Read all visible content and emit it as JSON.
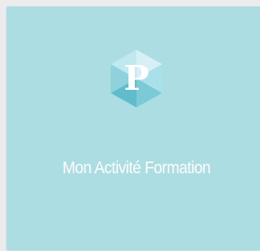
{
  "tile": {
    "title": "Mon Activité Formation",
    "background_color": "#acdde3",
    "text_color": "#ffffff"
  },
  "logo": {
    "icon": "hexagon-p-logo-icon",
    "letter": "P",
    "colors": {
      "hex_light": "#d6f0f5",
      "hex_mid": "#8fd2dd",
      "hex_dark": "#5ebccc",
      "letter": "#ffffff"
    }
  }
}
